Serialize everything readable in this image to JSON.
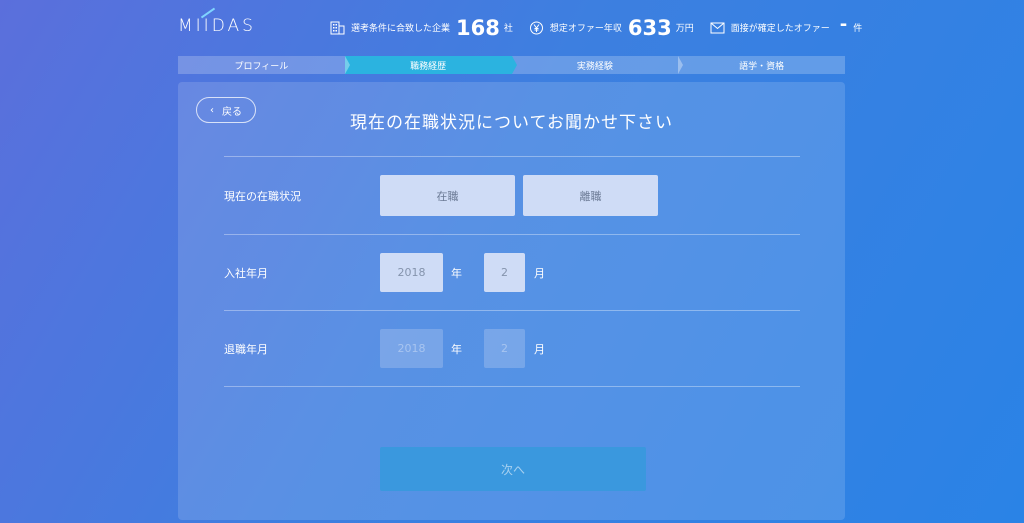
{
  "header": {
    "logo": "MIIDAS",
    "stats": [
      {
        "icon": "building-icon",
        "label": "選考条件に合致した企業",
        "value": "168",
        "unit": "社"
      },
      {
        "icon": "yen-icon",
        "label": "想定オファー年収",
        "value": "633",
        "unit": "万円"
      },
      {
        "icon": "mail-icon",
        "label": "面接が確定したオファー",
        "value": "-",
        "unit": "件"
      }
    ]
  },
  "steps": [
    {
      "label": "プロフィール",
      "active": false
    },
    {
      "label": "職務経歴",
      "active": true
    },
    {
      "label": "実務経験",
      "active": false
    },
    {
      "label": "語学・資格",
      "active": false
    }
  ],
  "card": {
    "back_label": "戻る",
    "title": "現在の在職状況についてお聞かせ下さい",
    "employment": {
      "label": "現在の在職状況",
      "options": [
        "在職",
        "離職"
      ]
    },
    "join_date": {
      "label": "入社年月",
      "year": "2018",
      "year_unit": "年",
      "month": "2",
      "month_unit": "月"
    },
    "leave_date": {
      "label": "退職年月",
      "year": "2018",
      "year_unit": "年",
      "month": "2",
      "month_unit": "月"
    },
    "next_label": "次へ"
  }
}
